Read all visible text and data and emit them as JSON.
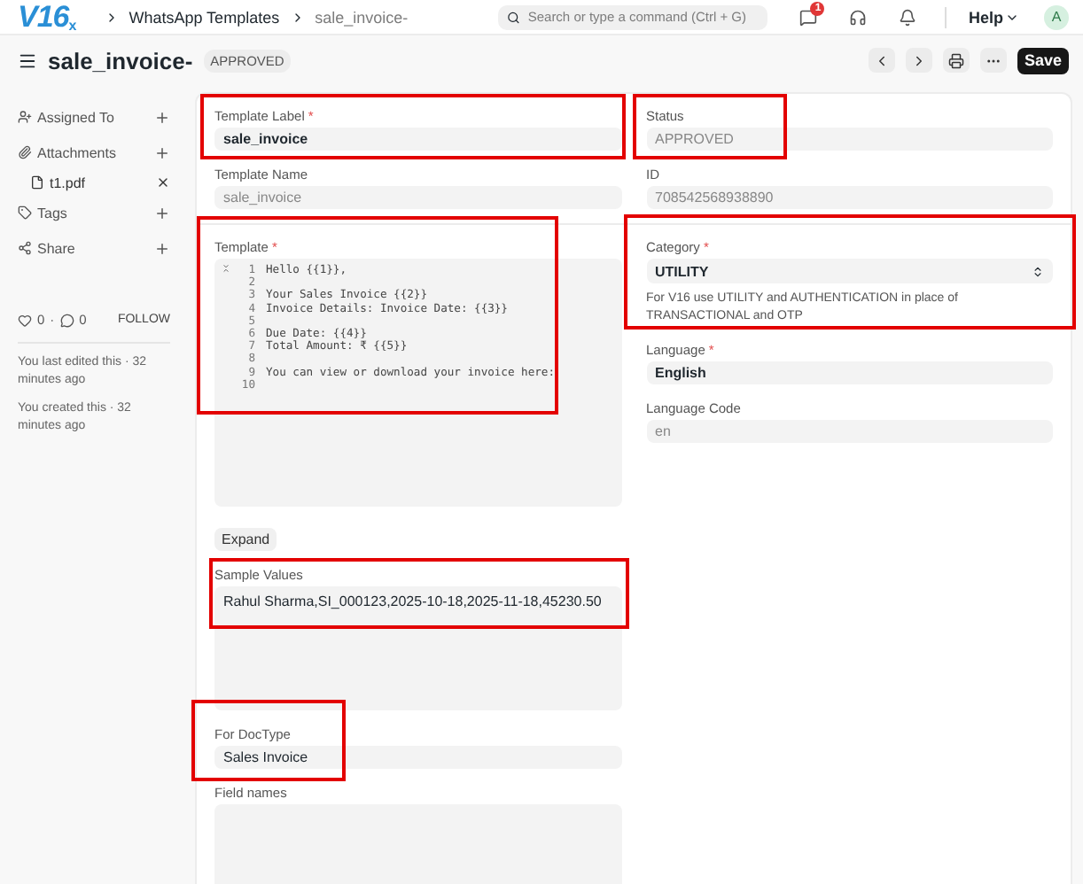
{
  "navbar": {
    "logo": "V16",
    "logo_suffix": "x",
    "breadcrumbs": [
      "WhatsApp Templates",
      "sale_invoice-"
    ],
    "search": {
      "placeholder": "Search or type a command (Ctrl + G)"
    },
    "notification_count": "1",
    "help": "Help",
    "avatar": "A"
  },
  "header": {
    "title": "sale_invoice-",
    "status": "APPROVED",
    "save": "Save"
  },
  "sidebar": {
    "items": [
      {
        "label": "Assigned To",
        "kind": "assign"
      },
      {
        "label": "Attachments",
        "kind": "attach"
      }
    ],
    "attachments": [
      "t1.pdf"
    ],
    "items2": [
      {
        "label": "Tags",
        "kind": "tag"
      },
      {
        "label": "Share",
        "kind": "share"
      }
    ],
    "likes": "0",
    "separator": "·",
    "comments": "0",
    "follow": "FOLLOW",
    "activity": [
      "You last edited this · 32 minutes ago",
      "You created this · 32 minutes ago"
    ]
  },
  "left_top": [
    {
      "label": "Template Label",
      "required_mark": "*",
      "value": "sale_invoice",
      "readonly": false,
      "highlighted": true
    },
    {
      "label": "Template Name",
      "value": "sale_invoice",
      "readonly": true
    }
  ],
  "right_top": [
    {
      "label": "Status",
      "value": "APPROVED",
      "readonly": true,
      "highlighted": true
    },
    {
      "label": "ID",
      "value": "708542568938890",
      "readonly": true
    }
  ],
  "template": {
    "label": "Template",
    "required_mark": "*",
    "highlighted": true,
    "lines": [
      {
        "number": "1",
        "text": "Hello {{1}},"
      },
      {
        "number": "2"
      },
      {
        "number": "3",
        "text": "Your Sales Invoice {{2}}"
      },
      {
        "number": "4",
        "text": "Invoice Details: Invoice Date: {{3}}"
      },
      {
        "number": "5"
      },
      {
        "number": "6",
        "text": "Due Date: {{4}}"
      },
      {
        "number": "7",
        "text": "Total Amount: ₹ {{5}}"
      },
      {
        "number": "8"
      },
      {
        "number": "9",
        "text": "You can view or download your invoice here:"
      },
      {
        "number": "10"
      }
    ],
    "expand": "Expand"
  },
  "sample_values": {
    "label": "Sample Values",
    "value": "Rahul Sharma,SI_000123,2025-10-18,2025-11-18,45230.50",
    "highlighted": true
  },
  "for_doctype": {
    "label": "For DocType",
    "value": "Sales Invoice",
    "highlighted": true
  },
  "field_names": {
    "label": "Field names"
  },
  "category": {
    "label": "Category",
    "required_mark": "*",
    "value": "UTILITY",
    "help": "For V16 use UTILITY and AUTHENTICATION in place of TRANSACTIONAL and OTP",
    "highlighted": true
  },
  "right_bottom": [
    {
      "label": "Language",
      "required_mark": "*",
      "value": "English",
      "readonly": false
    },
    {
      "label": "Language Code",
      "value": "en",
      "readonly": true
    }
  ]
}
